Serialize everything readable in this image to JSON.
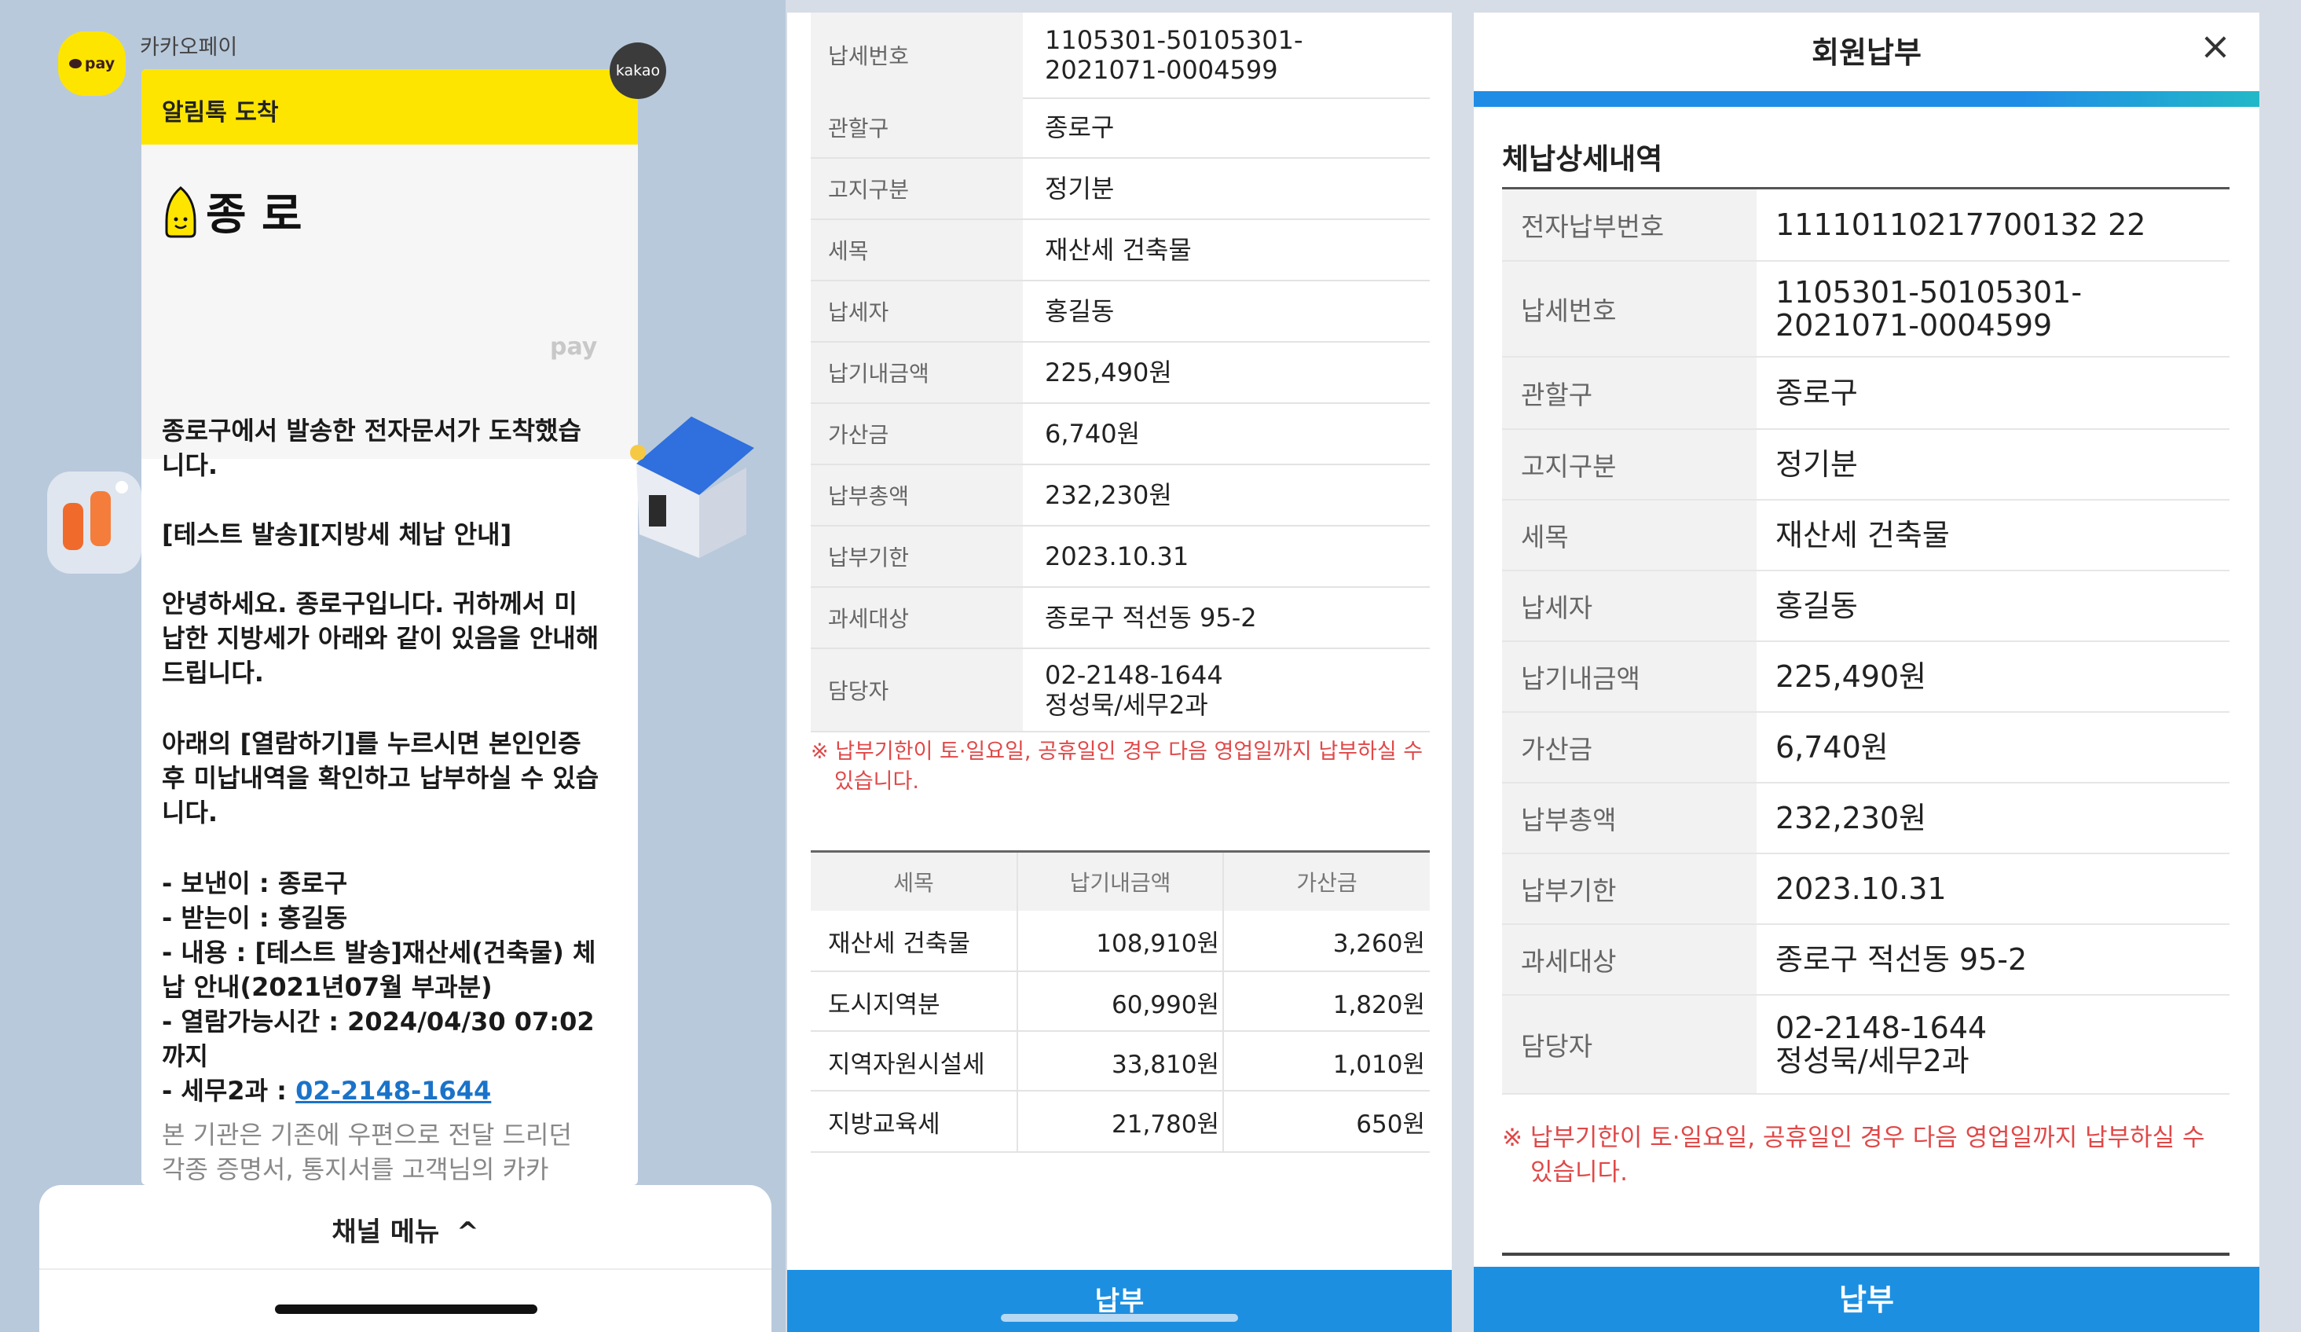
{
  "chat": {
    "sender_name": "카카오페이",
    "avatar_text": "pay",
    "badge_text": "kakao",
    "card_header": "알림톡 도착",
    "banner_title": "종 로",
    "banner_watermark": "pay",
    "messages": [
      "종로구에서 발송한 전자문서가 도착했습",
      "니다.",
      "[테스트 발송][지방세 체납 안내]",
      "안녕하세요. 종로구입니다. 귀하께서 미",
      "납한 지방세가 아래와 같이 있음을 안내해",
      " 드립니다.",
      "아래의 [열람하기]를 누르시면 본인인증",
      "후 미납내역을 확인하고 납부하실 수 있습",
      "니다.",
      "- 보낸이 : 종로구",
      "- 받는이 : 홍길동",
      "- 내용 : [테스트 발송]재산세(건축물) 체",
      "납 안내(2021년07월 부과분)",
      "- 열람가능시간 : 2024/04/30 07:02",
      "까지",
      "- 세무2과 : ",
      "본 기관은 기존에 우편으로 전달 드리던",
      "각종 증명서, 통지서를 고객님의 카카"
    ],
    "phone_link": "02-2148-1644",
    "channel_menu": "채널 메뉴",
    "channel_menu_chevron": "^"
  },
  "detail": {
    "rows": [
      {
        "label": "납세번호",
        "value": "1105301-50105301-",
        "value2": "2021071-0004599"
      },
      {
        "label": "관할구",
        "value": "종로구"
      },
      {
        "label": "고지구분",
        "value": "정기분"
      },
      {
        "label": "세목",
        "value": "재산세 건축물"
      },
      {
        "label": "납세자",
        "value": "홍길동"
      },
      {
        "label": "납기내금액",
        "value": "225,490원"
      },
      {
        "label": "가산금",
        "value": "6,740원"
      },
      {
        "label": "납부총액",
        "value": "232,230원"
      },
      {
        "label": "납부기한",
        "value": "2023.10.31"
      },
      {
        "label": "과세대상",
        "value": "종로구 적선동 95-2"
      },
      {
        "label": "담당자",
        "value": "02-2148-1644",
        "value2": "정성묵/세무2과"
      }
    ],
    "note_line1": "※ 납부기한이 토·일요일, 공휴일인 경우 다음 영업일까지 납부하실 수",
    "note_line2": "있습니다.",
    "table_headers": [
      "세목",
      "납기내금액",
      "가산금"
    ],
    "table_rows": [
      [
        "재산세 건축물",
        "108,910원",
        "3,260원"
      ],
      [
        "도시지역분",
        "60,990원",
        "1,820원"
      ],
      [
        "지역자원시설세",
        "33,810원",
        "1,010원"
      ],
      [
        "지방교육세",
        "21,780원",
        "650원"
      ]
    ],
    "pay_button": "납부"
  },
  "member": {
    "title": "회원납부",
    "close_icon": "×",
    "section_title": "체납상세내역",
    "rows": [
      {
        "label": "전자납부번호",
        "value": "11110110217700132 22"
      },
      {
        "label": "납세번호",
        "value": "1105301-50105301-",
        "value2": "2021071-0004599"
      },
      {
        "label": "관할구",
        "value": "종로구"
      },
      {
        "label": "고지구분",
        "value": "정기분"
      },
      {
        "label": "세목",
        "value": "재산세 건축물"
      },
      {
        "label": "납세자",
        "value": "홍길동"
      },
      {
        "label": "납기내금액",
        "value": "225,490원"
      },
      {
        "label": "가산금",
        "value": "6,740원"
      },
      {
        "label": "납부총액",
        "value": "232,230원"
      },
      {
        "label": "납부기한",
        "value": "2023.10.31"
      },
      {
        "label": "과세대상",
        "value": "종로구 적선동 95-2"
      },
      {
        "label": "담당자",
        "value": "02-2148-1644",
        "value2": "정성묵/세무2과"
      }
    ],
    "note_line1": "※ 납부기한이 토·일요일, 공휴일인 경우 다음 영업일까지 납부하실 수",
    "note_line2": "있습니다.",
    "pay_button": "납부"
  }
}
